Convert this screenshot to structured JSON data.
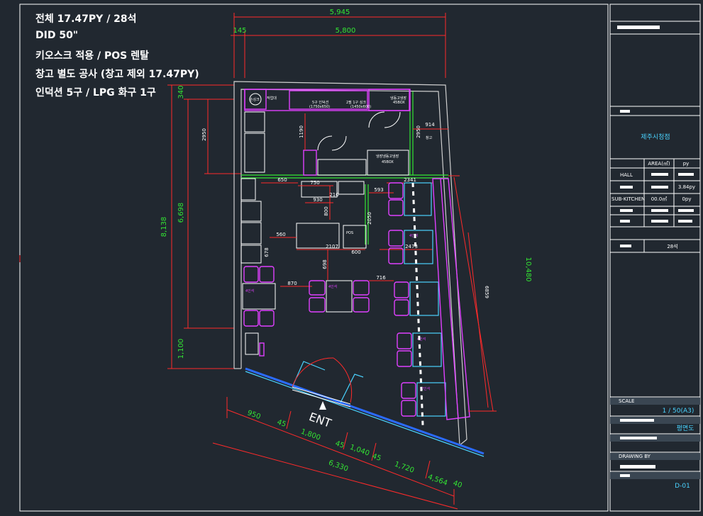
{
  "notes": [
    "전체 17.47PY / 28석",
    "DID 50\"",
    "키오스크 적용 / POS 렌탈",
    "창고 별도 공사 (창고 제외 17.47PY)",
    "인덕션 5구 / LPG 화구 1구"
  ],
  "dimensions": {
    "top_overall": "5,945",
    "top_inner": "5,800",
    "top_offset": "145",
    "left_overall": "8,138",
    "left_mid": "6,698",
    "left_bottom": "1,100",
    "left_top": "340",
    "left_kitchen": "2950",
    "right_diag": "10,480",
    "right_inner": "6859",
    "right_kitchen_a": "2950",
    "right_kitchen_b": "914",
    "bottom_950": "950",
    "bottom_45a": "45",
    "bottom_1800": "1,800",
    "bottom_45b": "45",
    "bottom_1040": "1,040",
    "bottom_45c": "45",
    "bottom_1720": "1,720",
    "bottom_4564": "4,564",
    "bottom_40": "40",
    "bottom_6330": "6,330",
    "d650": "650",
    "d750": "750",
    "d930": "930",
    "d210": "210",
    "d800": "800",
    "d560": "560",
    "d2107": "2107",
    "d600": "600",
    "d2050": "2050",
    "d593": "593",
    "d2341": "2341",
    "d2473": "2473",
    "d870": "870",
    "d716": "716",
    "d698": "698",
    "d678": "678",
    "d1190": "1190"
  },
  "room_labels": {
    "storage": "창고",
    "induction": "5구 인덕션",
    "induction_dim": "(1750x650)",
    "sink": "2필 1구 싱크",
    "sink_dim": "(1450x600)",
    "fridge45": "45BOX",
    "fridge_top": "냉동고냉장",
    "fridge_mid": "냉장냉동고냉장",
    "shelf": "작업대",
    "pos": "POS",
    "hand_sink": "손싱크",
    "seat4": "4인석",
    "seat2": "2인석",
    "entrance": "ENT"
  },
  "title_block": {
    "project": "제주시청점",
    "area_header": "AREA(㎡)",
    "py_header": "py",
    "row_hall": "HALL",
    "row_hall_py": "3.84py",
    "row_sub": "SUB-KITCHEN",
    "row_sub_area": "00.0㎡",
    "row_sub_py": "0py",
    "seats": "28석",
    "scale_label": "SCALE",
    "scale_value": "1 / 50(A3)",
    "drawing_name": "평면도",
    "drawing_by": "DRAWING BY",
    "drawing_no": "D-01"
  },
  "colors": {
    "background": "#212830",
    "dimension": "#ff2a2a",
    "dimension_text": "#33e633",
    "furniture": "#e040ff",
    "glass": "#4ad3ff",
    "wall": "#cfcfcf"
  }
}
